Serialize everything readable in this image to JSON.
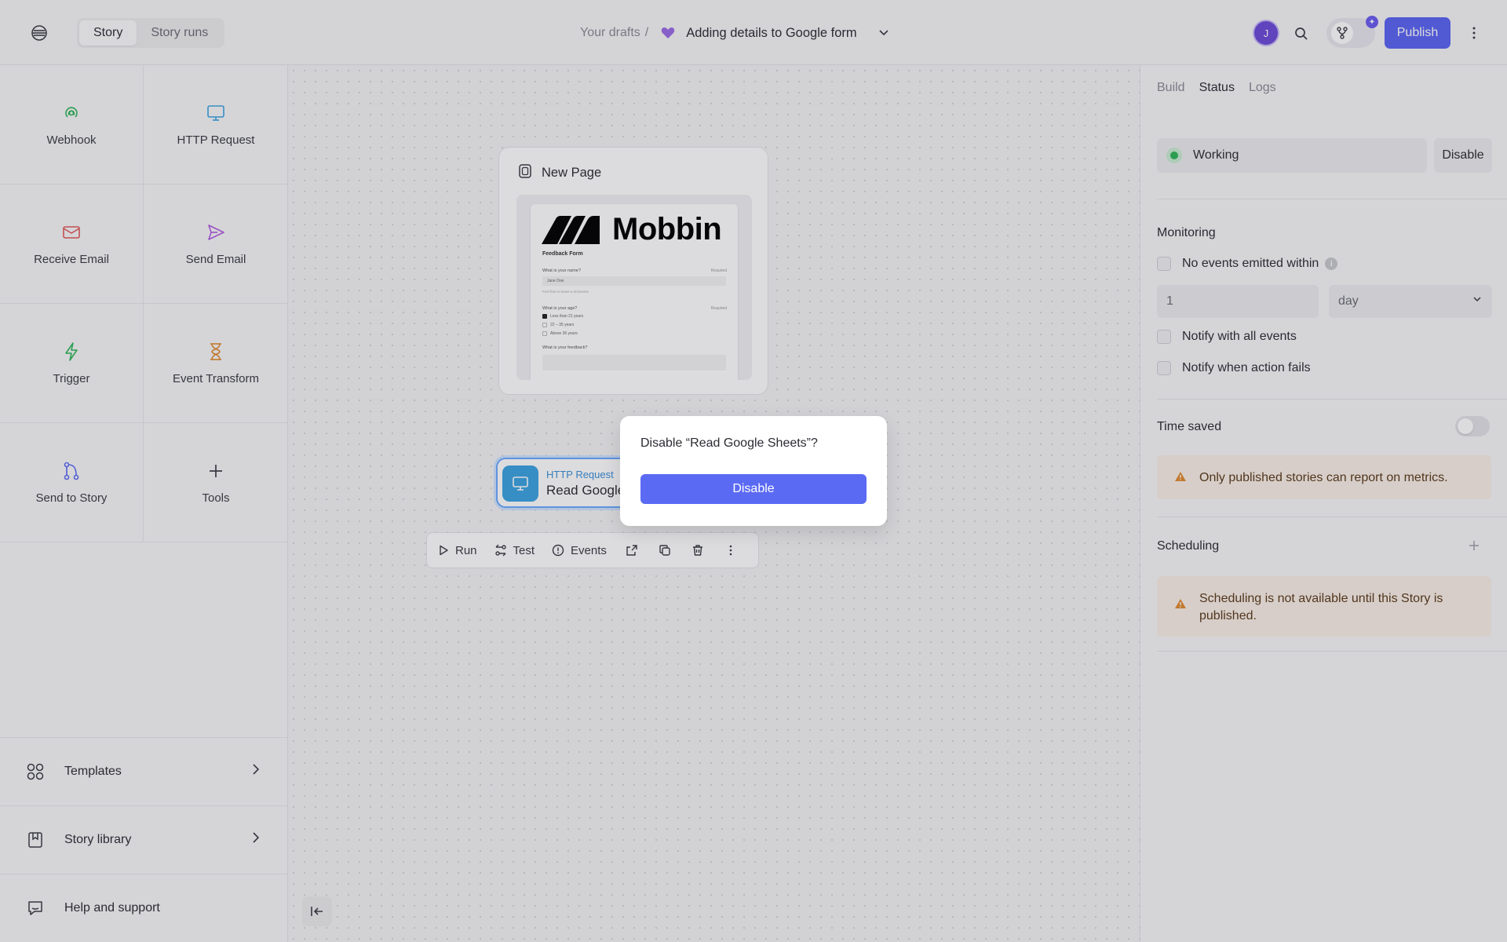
{
  "header": {
    "tabs": [
      {
        "label": "Story",
        "active": true
      },
      {
        "label": "Story runs",
        "active": false
      }
    ],
    "breadcrumb": {
      "parent": "Your drafts",
      "separator": "/",
      "title": "Adding details to Google form"
    },
    "avatar_initial": "J",
    "publish_label": "Publish"
  },
  "sidebar": {
    "tools": [
      {
        "label": "Webhook",
        "icon": "webhook-icon",
        "color": "#2fb457"
      },
      {
        "label": "HTTP Request",
        "icon": "monitor-icon",
        "color": "#3aa3e0"
      },
      {
        "label": "Receive Email",
        "icon": "envelope-icon",
        "color": "#e05757"
      },
      {
        "label": "Send Email",
        "icon": "send-icon",
        "color": "#b05ae0"
      },
      {
        "label": "Trigger",
        "icon": "lightning-icon",
        "color": "#2fb457"
      },
      {
        "label": "Event Transform",
        "icon": "hourglass-icon",
        "color": "#e08a2f"
      },
      {
        "label": "Send to Story",
        "icon": "branch-icon",
        "color": "#5b6af3"
      },
      {
        "label": "Tools",
        "icon": "plus-icon",
        "color": "#3a3a44"
      }
    ],
    "bottom": [
      {
        "label": "Templates",
        "icon": "grid-icon"
      },
      {
        "label": "Story library",
        "icon": "library-icon"
      },
      {
        "label": "Help and support",
        "icon": "help-icon"
      }
    ]
  },
  "canvas": {
    "page_node": {
      "title": "New Page",
      "preview": {
        "brand": "Mobbin",
        "form_title": "Feedback Form",
        "q1": "What is your name?",
        "required": "Required",
        "q1_value": "Jane Doe",
        "q1_hint": "Feel free to leave a nickname",
        "q2": "What is your age?",
        "options": [
          "Less than 21 years",
          "22 – 35 years",
          "Above 36 years"
        ],
        "q3": "What is your feedback?"
      }
    },
    "http_node": {
      "type": "HTTP Request",
      "name": "Read Google Sheets"
    },
    "toolbar": {
      "run": "Run",
      "test": "Test",
      "events": "Events"
    }
  },
  "right_panel": {
    "tabs": [
      {
        "label": "Build",
        "active": false
      },
      {
        "label": "Status",
        "active": true
      },
      {
        "label": "Logs",
        "active": false
      }
    ],
    "status": {
      "text": "Working",
      "disable_label": "Disable",
      "color": "#2fb457"
    },
    "monitoring": {
      "title": "Monitoring",
      "no_events_label": "No events emitted within",
      "period_value": "1",
      "period_unit": "day",
      "notify_all": "Notify with all events",
      "notify_fail": "Notify when action fails"
    },
    "time_saved": {
      "title": "Time saved",
      "warning": "Only published stories can report on metrics."
    },
    "scheduling": {
      "title": "Scheduling",
      "warning": "Scheduling is not available until this Story is published."
    }
  },
  "modal": {
    "question": "Disable “Read Google Sheets”?",
    "confirm_label": "Disable"
  },
  "colors": {
    "accent": "#5a63f2",
    "warning": "#e08a2f"
  }
}
